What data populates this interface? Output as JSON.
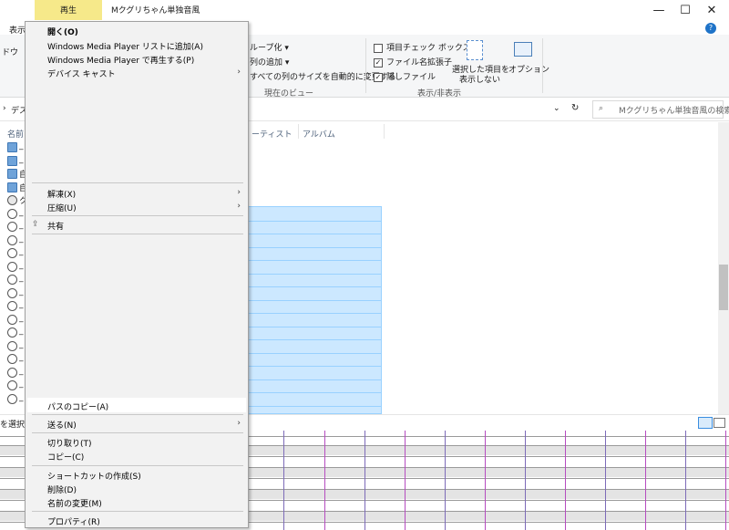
{
  "titlebar": {
    "tab_play": "再生",
    "title": "Mクグリちゃん単独音風",
    "min": "—",
    "max": "☐",
    "close": "✕"
  },
  "ribbon": {
    "tab_view": "表示",
    "tab_d": "ドウ",
    "help": "?",
    "group_by": "ループ化 ▾",
    "add_column": "列の追加 ▾",
    "autosize": "すべての列のサイズを自動的に変更する",
    "current_view": "現在のビュー",
    "item_checkboxes": "項目チェック ボックス",
    "file_ext": "ファイル名拡張子",
    "hidden_files": "隠しファイル",
    "hide_selected_line1": "選択した項目を",
    "hide_selected_line2": "表示しない",
    "options": "オプション",
    "show_hide": "表示/非表示",
    "chk_file_ext": "✓",
    "chk_hidden": "✓"
  },
  "address": {
    "breadcrumb": "デス",
    "search_placeholder": "Mクグリちゃん単独音風の検索"
  },
  "columns": {
    "name": "名前",
    "artist": "ーティスト",
    "album": "アルバム"
  },
  "file_rows": [
    "_",
    "_",
    "自",
    "自",
    "ク",
    "_",
    "_",
    "_",
    "_",
    "_",
    "_",
    "_",
    "_",
    "_",
    "_",
    "_",
    "_",
    "_",
    "_",
    "_"
  ],
  "status": {
    "selected": "を選択"
  },
  "menu": {
    "open": "開く(O)",
    "add_wmp_list": "Windows Media Player リストに追加(A)",
    "play_wmp": "Windows Media Player で再生する(P)",
    "cast": "デバイス キャスト",
    "extract": "解凍(X)",
    "compress": "圧縮(U)",
    "share": "共有",
    "copy_path": "パスのコピー(A)",
    "send_to": "送る(N)",
    "cut": "切り取り(T)",
    "copy": "コピー(C)",
    "create_shortcut": "ショートカットの作成(S)",
    "delete": "削除(D)",
    "rename": "名前の変更(M)",
    "properties": "プロパティ(R)"
  },
  "colors": {
    "play_tab": "#f6e98a",
    "selection": "#cce8ff",
    "menu_bg": "#f2f2f2"
  }
}
